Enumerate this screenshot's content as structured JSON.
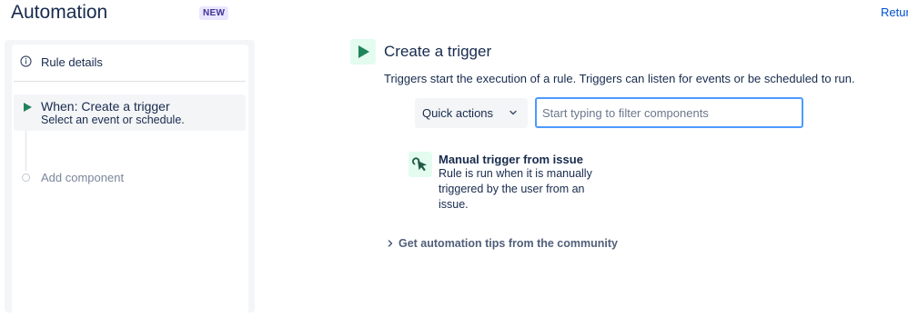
{
  "header": {
    "title": "Automation",
    "badge": "NEW",
    "return_link": "Retur"
  },
  "sidebar": {
    "rule_details_label": "Rule details",
    "rule_details_icon": "info-icon",
    "steps": [
      {
        "title": "When: Create a trigger",
        "subtitle": "Select an event or schedule.",
        "icon": "play-icon",
        "active": true
      }
    ],
    "add_component_label": "Add component"
  },
  "main": {
    "title": "Create a trigger",
    "title_icon": "play-icon",
    "description": "Triggers start the execution of a rule. Triggers can listen for events or be scheduled to run.",
    "quick_actions_label": "Quick actions",
    "filter_placeholder": "Start typing to filter components",
    "filter_value": "",
    "components": [
      {
        "icon": "cursor-click-icon",
        "title": "Manual trigger from issue",
        "description": "Rule is run when it is manually triggered by the user from an issue."
      }
    ],
    "tips_label": "Get automation tips from the community"
  },
  "colors": {
    "accent_green": "#1f845a",
    "icon_bg_green": "#e3fcef",
    "badge_bg": "#eae6ff",
    "badge_text": "#403294",
    "link_blue": "#0052cc",
    "focus_blue": "#4c9aff"
  }
}
